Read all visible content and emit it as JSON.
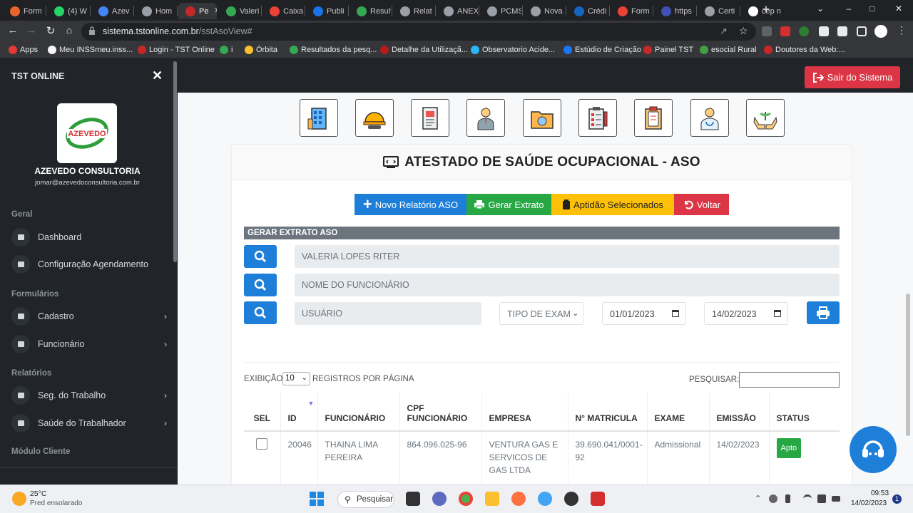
{
  "browser": {
    "tabs": [
      {
        "title": "Form",
        "color": "#e8642c"
      },
      {
        "title": "(4) W",
        "color": "#25d366"
      },
      {
        "title": "Azev",
        "color": "#4285f4"
      },
      {
        "title": "Hom",
        "color": "#9aa0a6"
      },
      {
        "title": "Pe",
        "color": "#c62828",
        "active": true
      },
      {
        "title": "Valeri",
        "color": "#34a853"
      },
      {
        "title": "Caixa",
        "color": "#ea4335"
      },
      {
        "title": "Publi",
        "color": "#1a73e8"
      },
      {
        "title": "Result",
        "color": "#34a853"
      },
      {
        "title": "Relat",
        "color": "#9aa0a6"
      },
      {
        "title": "ANEX",
        "color": "#9aa0a6"
      },
      {
        "title": "PCMS",
        "color": "#9aa0a6"
      },
      {
        "title": "Nova",
        "color": "#9aa0a6"
      },
      {
        "title": "Crédi",
        "color": "#1565c0"
      },
      {
        "title": "Form",
        "color": "#ea4335"
      },
      {
        "title": "https",
        "color": "#3f51b5"
      },
      {
        "title": "Certi",
        "color": "#9aa0a6"
      },
      {
        "title": "cep n",
        "color": "#ffffff"
      }
    ],
    "url_host": "sistema.tstonline.com.br",
    "url_path": "/sstAsoView#",
    "bookmarks": [
      {
        "label": "Apps",
        "color": "#e53935"
      },
      {
        "label": "Meu INSSmeu.inss...",
        "color": "#f5f5f5"
      },
      {
        "label": "Login - TST Online",
        "color": "#c62828"
      },
      {
        "label": "i",
        "color": "#34a853"
      },
      {
        "label": "Órbita",
        "color": "#fbc02d"
      },
      {
        "label": "Resultados da pesq...",
        "color": "#34a853"
      },
      {
        "label": "Detalhe da Utilizaçã...",
        "color": "#b71c1c"
      },
      {
        "label": "Observatorio Acide...",
        "color": "#29b6f6"
      },
      {
        "label": "Estúdio de Criação",
        "color": "#1877f2"
      },
      {
        "label": "Painel TST",
        "color": "#c62828"
      },
      {
        "label": "esocial Rural",
        "color": "#43a047"
      },
      {
        "label": "Doutores da Web:...",
        "color": "#c62828"
      }
    ]
  },
  "sidebar": {
    "title": "TST ONLINE",
    "logo_text": "AZEVEDO",
    "company": "AZEVEDO CONSULTORIA",
    "email": "jomar@azevedoconsultoria.com.br",
    "sections": {
      "geral": "Geral",
      "formularios": "Formulários",
      "relatorios": "Relatórios",
      "modulo_cliente": "Módulo Cliente"
    },
    "items": {
      "dashboard": "Dashboard",
      "config_agendamento": "Configuração Agendamento",
      "cadastro": "Cadastro",
      "funcionario": "Funcionário",
      "seg_trabalho": "Seg. do Trabalho",
      "saude_trabalhador": "Saúde do Trabalhador"
    }
  },
  "header": {
    "logout_label": "Sair do Sistema"
  },
  "page": {
    "title": "ATESTADO DE SAÚDE OCUPACIONAL - ASO",
    "actions": {
      "novo": "Novo Relatório ASO",
      "extrato": "Gerar Extrato",
      "aptidao": "Aptidão Selecionados",
      "voltar": "Voltar"
    },
    "section_title": "GERAR EXTRATO ASO",
    "filters": {
      "empresa": "VALERIA LOPES RITER",
      "funcionario_placeholder": "NOME DO FUNCIONÁRIO",
      "usuario_placeholder": "USUÁRIO",
      "tipo_exame": "TIPO DE EXAM",
      "date_from": "01/01/2023",
      "date_to": "14/02/2023"
    },
    "table_controls": {
      "exibicao": "EXIBIÇÃO",
      "page_size": "10",
      "registros": "REGISTROS POR PÁGINA",
      "pesquisar": "PESQUISAR:"
    },
    "columns": [
      "SEL",
      "ID",
      "FUNCIONÁRIO",
      "CPF FUNCIONÁRIO",
      "EMPRESA",
      "N° MATRICULA",
      "EXAME",
      "EMISSÃO",
      "STATUS"
    ],
    "rows": [
      {
        "id": "20046",
        "funcionario": "THAINA LIMA PEREIRA",
        "cpf": "864.096.025-96",
        "empresa": "VENTURA GAS E SERVICOS DE GAS LTDA",
        "matricula": "39.690.041/0001-92",
        "exame": "Admissional",
        "emissao": "14/02/2023",
        "status": "Apto"
      }
    ]
  },
  "taskbar": {
    "temperature": "25°C",
    "weather": "Pred ensolarado",
    "search": "Pesquisar",
    "time": "09:53",
    "date": "14/02/2023"
  }
}
